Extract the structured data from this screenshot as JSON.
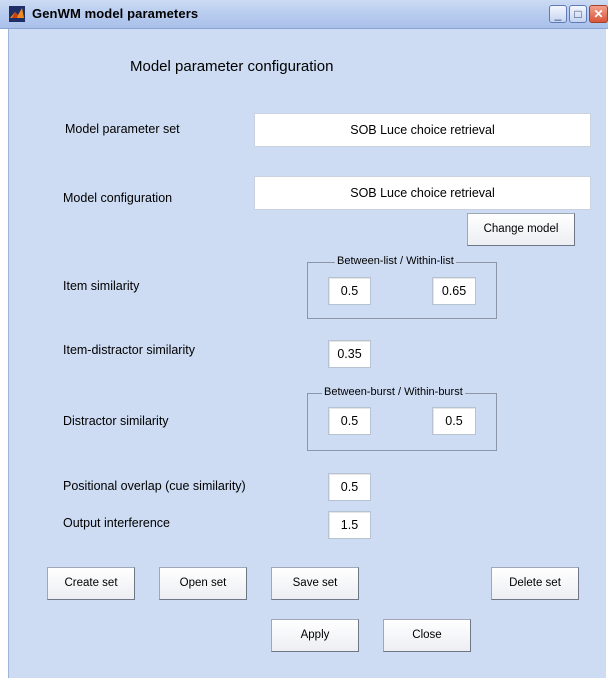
{
  "window": {
    "title": "GenWM model parameters"
  },
  "heading": "Model parameter configuration",
  "parameter_set": {
    "label": "Model parameter set",
    "value": "SOB Luce choice retrieval"
  },
  "model_configuration": {
    "label": "Model configuration",
    "value": "SOB Luce choice retrieval",
    "change_button": "Change model"
  },
  "item_similarity": {
    "label": "Item similarity",
    "group_title": "Between-list / Within-list",
    "between_value": "0.5",
    "within_value": "0.65"
  },
  "item_distractor_similarity": {
    "label": "Item-distractor similarity",
    "value": "0.35"
  },
  "distractor_similarity": {
    "label": "Distractor similarity",
    "group_title": "Between-burst / Within-burst",
    "between_value": "0.5",
    "within_value": "0.5"
  },
  "positional_overlap": {
    "label": "Positional overlap (cue similarity)",
    "value": "0.5"
  },
  "output_interference": {
    "label": "Output interference",
    "value": "1.5"
  },
  "buttons": {
    "create_set": "Create set",
    "open_set": "Open set",
    "save_set": "Save set",
    "delete_set": "Delete set",
    "apply": "Apply",
    "close": "Close"
  },
  "titlebar_buttons": {
    "minimize": "_",
    "maximize": "□",
    "close": "✕"
  },
  "colors": {
    "client_background": "#cddcf3",
    "title_gradient_start": "#cddbf3",
    "close_button": "#d9543a"
  }
}
